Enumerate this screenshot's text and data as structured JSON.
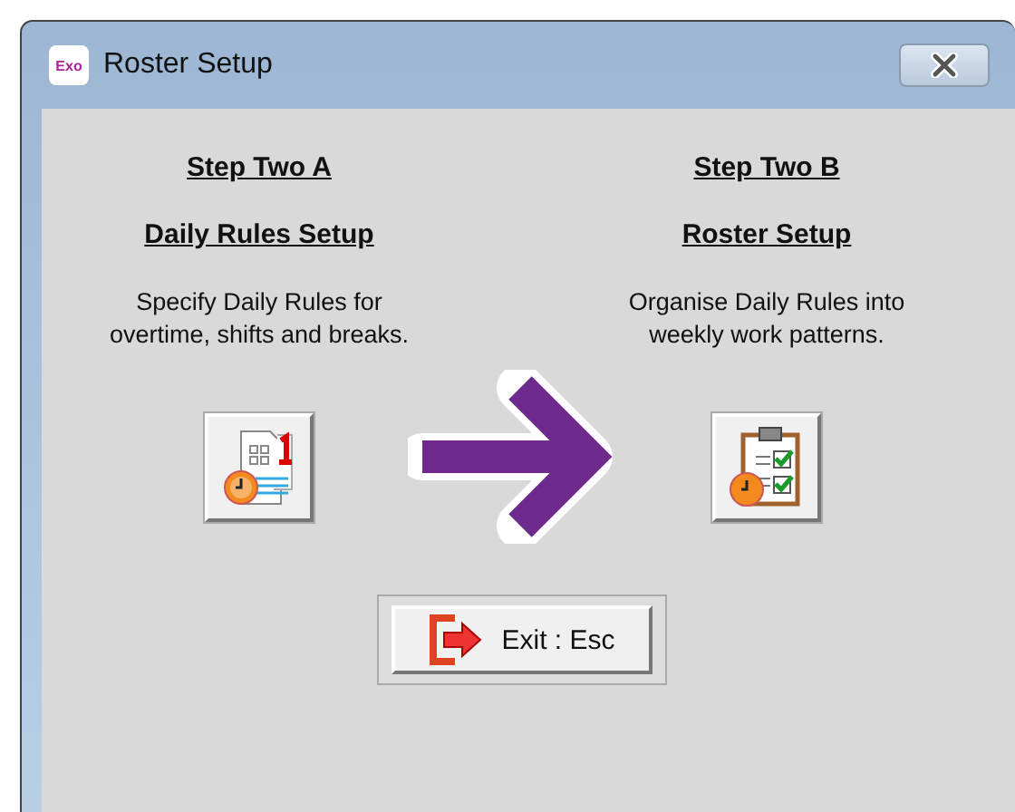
{
  "window": {
    "title": "Roster Setup",
    "app_icon_text": "Exo"
  },
  "steps": [
    {
      "step": "Step Two A",
      "heading": "Daily Rules Setup",
      "description": "Specify Daily Rules for overtime, shifts and breaks.",
      "kind": "daily"
    },
    {
      "step": "Step Two B",
      "heading": "Roster Setup",
      "description": "Organise Daily Rules into weekly work patterns.",
      "kind": "roster"
    }
  ],
  "exit_button": {
    "label": "Exit : Esc"
  }
}
